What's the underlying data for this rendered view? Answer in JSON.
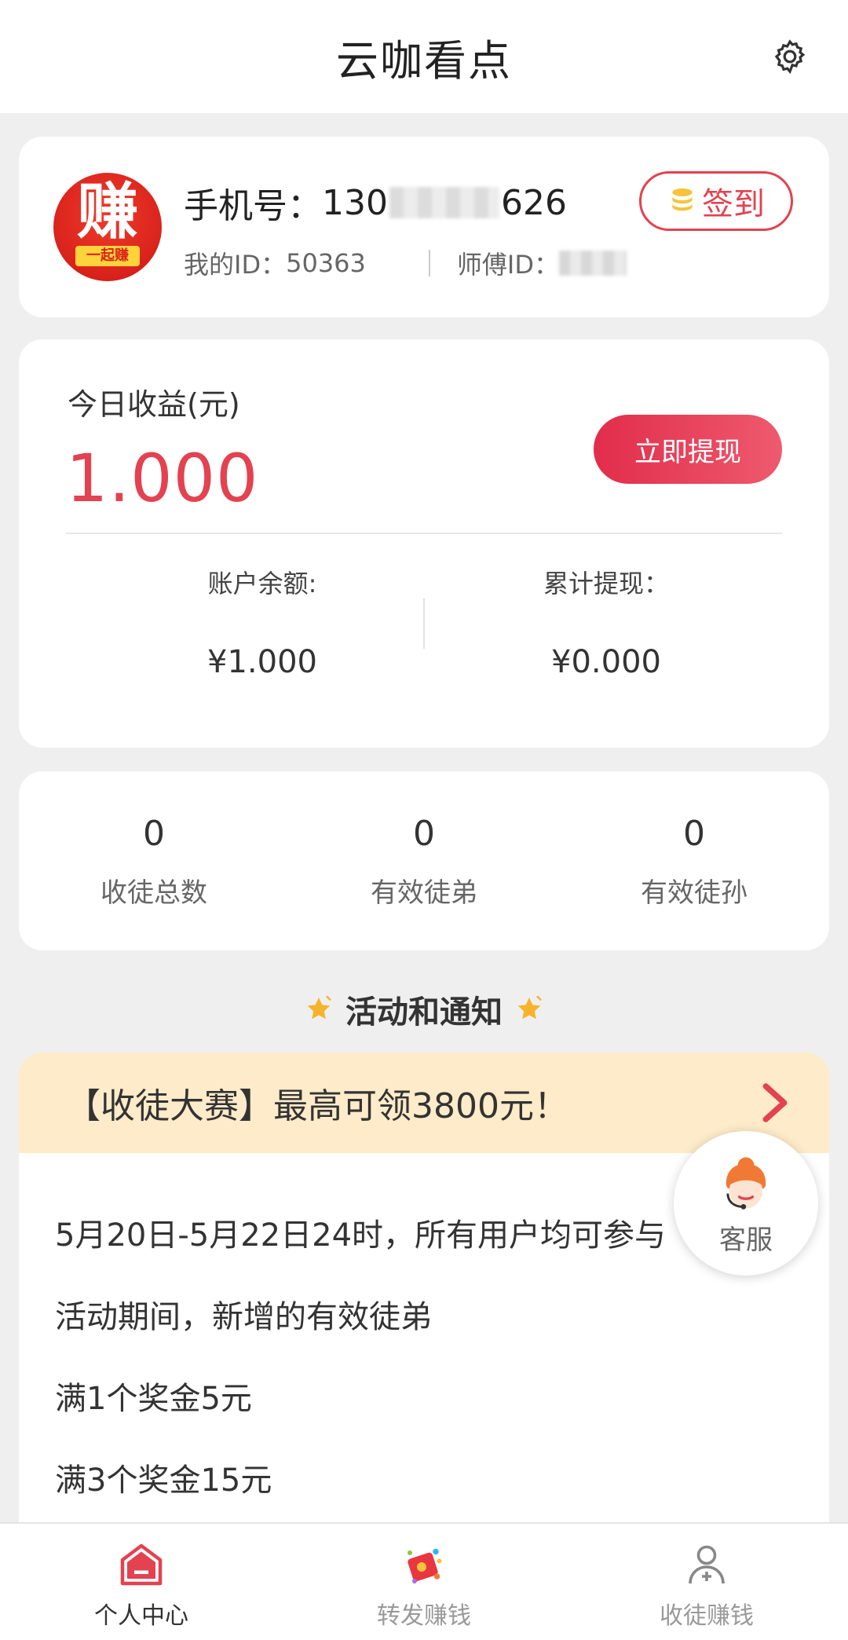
{
  "header": {
    "title": "云咖看点"
  },
  "profile": {
    "avatar_text": "赚",
    "avatar_ribbon": "一起赚",
    "phone_label": "手机号：",
    "phone_prefix": "130",
    "phone_suffix": "626",
    "my_id_label": "我的ID：",
    "my_id": "50363",
    "master_id_label": "师傅ID：",
    "signin_label": "签到"
  },
  "earnings": {
    "today_label": "今日收益(元)",
    "today_amount": "1.000",
    "withdraw_label": "立即提现",
    "balance_label": "账户余额:",
    "balance_value": "¥1.000",
    "total_withdraw_label": "累计提现：",
    "total_withdraw_value": "¥0.000"
  },
  "counts": [
    {
      "value": "0",
      "label": "收徒总数"
    },
    {
      "value": "0",
      "label": "有效徒弟"
    },
    {
      "value": "0",
      "label": "有效徒孙"
    }
  ],
  "section": {
    "title": "活动和通知"
  },
  "banner": {
    "text": "【收徒大赛】最高可领3800元！"
  },
  "notice_lines": [
    "5月20日-5月22日24时，所有用户均可参与",
    "活动期间，新增的有效徒弟",
    "满1个奖金5元",
    "满3个奖金15元"
  ],
  "kefu": {
    "label": "客服"
  },
  "tabbar": [
    {
      "label": "个人中心",
      "active": true
    },
    {
      "label": "转发赚钱",
      "active": false
    },
    {
      "label": "收徒赚钱",
      "active": false
    }
  ],
  "colors": {
    "accent": "#e34250",
    "banner_bg": "#fdebc9",
    "gold": "#f7c33a"
  }
}
